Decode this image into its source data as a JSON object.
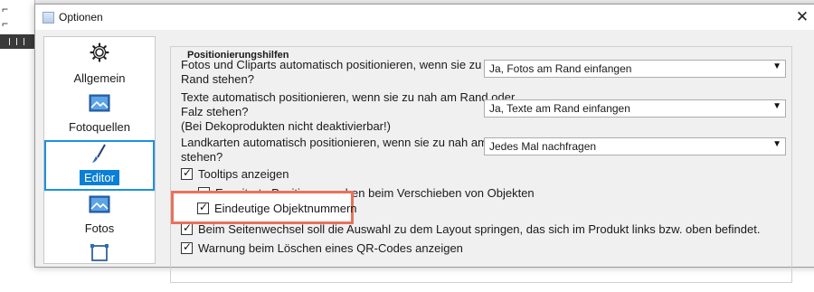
{
  "dialog": {
    "title": "Optionen",
    "close_glyph": "✕"
  },
  "sidebar": {
    "items": [
      {
        "label": "Allgemein",
        "icon": "gear-icon"
      },
      {
        "label": "Fotoquellen",
        "icon": "image-icon"
      },
      {
        "label": "Editor",
        "icon": "brush-icon",
        "selected": true
      },
      {
        "label": "Fotos",
        "icon": "image-icon"
      },
      {
        "label": "",
        "icon": "layout-icon"
      }
    ]
  },
  "positioning": {
    "group_title": "Positionierungshilfen",
    "rows": [
      {
        "question": "Fotos und Cliparts automatisch positionieren, wenn sie zu nah am Rand stehen?",
        "line1": "Fotos und Cliparts automatisch positionieren, wenn sie zu nah am",
        "line2": "Rand stehen?",
        "value": "Ja, Fotos am Rand einfangen"
      },
      {
        "line1": "Texte automatisch positionieren, wenn sie zu nah am Rand oder",
        "line2": "Falz stehen?",
        "line3": "(Bei Dekoprodukten nicht deaktivierbar!)",
        "value": "Ja, Texte am Rand einfangen"
      },
      {
        "line1": "Landkarten automatisch positionieren, wenn sie zu nah am Rand",
        "line2": "stehen?",
        "value": "Jedes Mal nachfragen"
      }
    ],
    "checkboxes": [
      {
        "label": "Tooltips anzeigen",
        "checked": true
      },
      {
        "label": "Erweiterte Positionsangaben beim Verschieben von Objekten",
        "checked": false
      },
      {
        "label": "Eindeutige Objektnummern",
        "checked": true
      },
      {
        "label": "Beim Seitenwechsel soll die Auswahl zu dem Layout springen, das sich im Produkt links bzw. oben befindet.",
        "checked": true
      },
      {
        "label": "Warnung beim Löschen eines QR-Codes anzeigen",
        "checked": true
      }
    ]
  },
  "colors": {
    "highlight": "#e8725b",
    "selection": "#0a7fd6"
  }
}
